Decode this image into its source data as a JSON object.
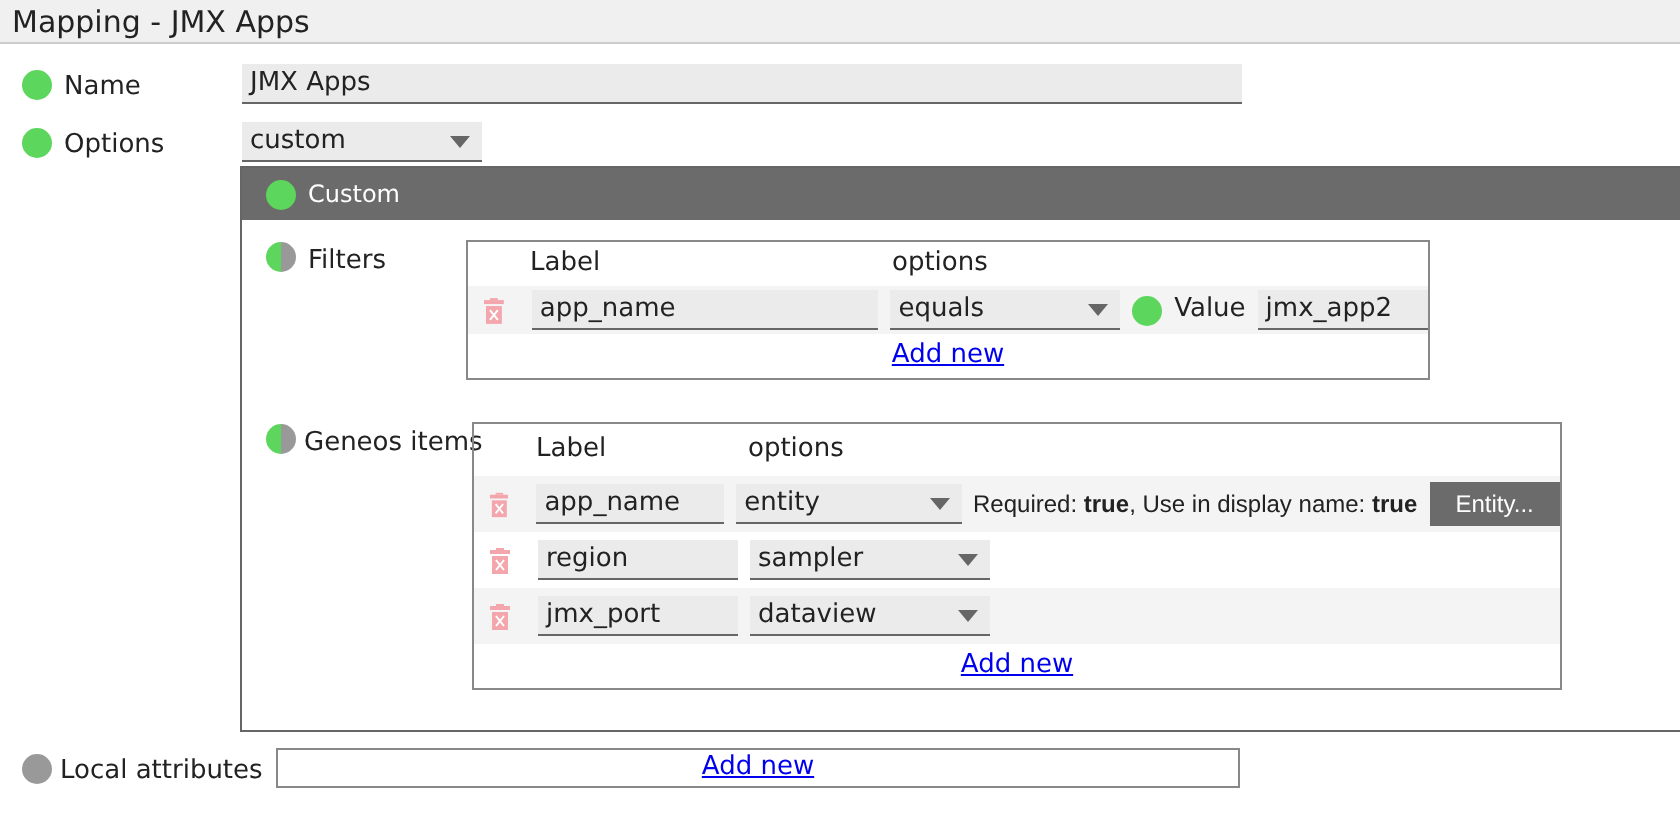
{
  "title": "Mapping - JMX Apps",
  "name": {
    "label": "Name",
    "valid": true,
    "partial": false,
    "value": "JMX Apps"
  },
  "options": {
    "label": "Options",
    "valid": true,
    "partial": false,
    "value": "custom"
  },
  "custom": {
    "title": "Custom",
    "valid": true,
    "partial": false,
    "filters": {
      "label": "Filters",
      "valid": true,
      "partial": true,
      "columns": [
        "Label",
        "options"
      ],
      "rows": [
        {
          "label": "app_name",
          "option": "equals",
          "value_valid": true,
          "value_label": "Value",
          "value": "jmx_app2"
        }
      ],
      "add": "Add new"
    },
    "geneos_items": {
      "label": "Geneos items",
      "valid": true,
      "partial": true,
      "columns": [
        "Label",
        "options"
      ],
      "rows": [
        {
          "label": "app_name",
          "option": "entity",
          "info": "Required: **true**, Use in display name: **true**",
          "button": "Entity..."
        },
        {
          "label": "region",
          "option": "sampler"
        },
        {
          "label": "jmx_port",
          "option": "dataview"
        }
      ],
      "add": "Add new"
    }
  },
  "local_attributes": {
    "label": "Local attributes",
    "valid": false,
    "add": "Add new"
  }
}
